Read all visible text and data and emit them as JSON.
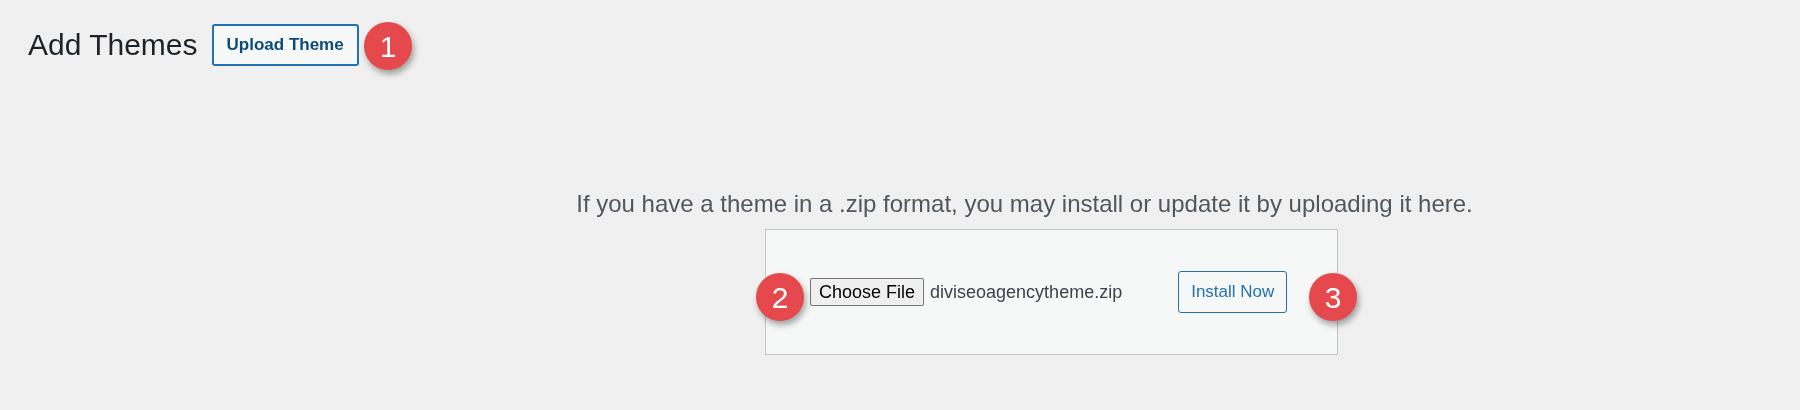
{
  "heading": "Add Themes",
  "upload_button": "Upload Theme",
  "instructions": "If you have a theme in a .zip format, you may install or update it by uploading it here.",
  "upload_form": {
    "choose_button": "Choose File",
    "file_name": "diviseoagencytheme.zip",
    "install_button": "Install Now"
  },
  "callouts": [
    "1",
    "2",
    "3"
  ]
}
